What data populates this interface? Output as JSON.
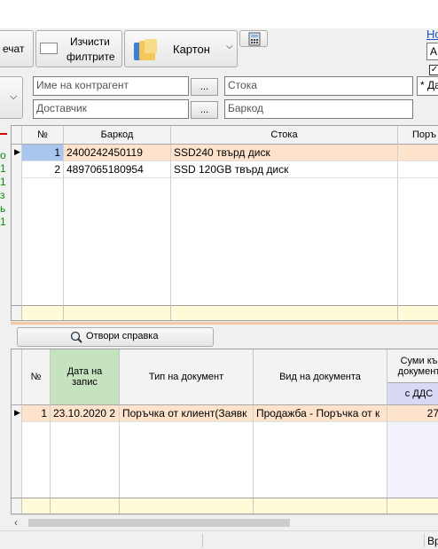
{
  "toolbar": {
    "print_label_partial": "ечат",
    "clear_filters_line1": "Изчисти",
    "clear_filters_line2": "филтрите",
    "card_label": "Картон",
    "right_link_partial": "Но",
    "right_field_partial": "А",
    "checkbox_checked": true
  },
  "filters": {
    "contractor_placeholder": "Име на контрагент",
    "supplier_placeholder": "Доставчик",
    "item_placeholder": "Стока",
    "barcode_placeholder": "Баркод",
    "browse_label": "...",
    "right_partial": "* Да"
  },
  "left_strip": {
    "labels": [
      "о",
      "1",
      "1",
      "з",
      "ь",
      "1"
    ]
  },
  "upper_grid": {
    "columns": [
      "№",
      "Баркод",
      "Стока",
      "Поръ"
    ],
    "rows": [
      {
        "num": "1",
        "barcode": "2400242450119",
        "item": "SSD240 твърд диск"
      },
      {
        "num": "2",
        "barcode": "4897065180954",
        "item": "SSD 120GB твърд диск"
      }
    ]
  },
  "report_button": "Отвори справка",
  "lower_grid": {
    "columns": {
      "num": "№",
      "date_line1": "Дата на",
      "date_line2": "запис",
      "doc_type": "Тип на документ",
      "doc_kind": "Вид на документа",
      "sum_line1": "Суми къ",
      "sum_line2": "документ",
      "sum_sub": "с ДДС"
    },
    "rows": [
      {
        "num": "1",
        "date": "23.10.2020 2",
        "doc_type": "Поръчка от клиент(Заявк",
        "doc_kind": "Продажба - Поръчка от к",
        "sum": "273,"
      }
    ]
  },
  "status": {
    "right_partial": "Вр"
  },
  "colors": {
    "selected_row": "#fde3cc",
    "cursor_cell": "#a7c7ef",
    "date_header": "#c5e3bf",
    "sum_sub_header": "#d8daf5",
    "footer": "#fffbd8"
  }
}
